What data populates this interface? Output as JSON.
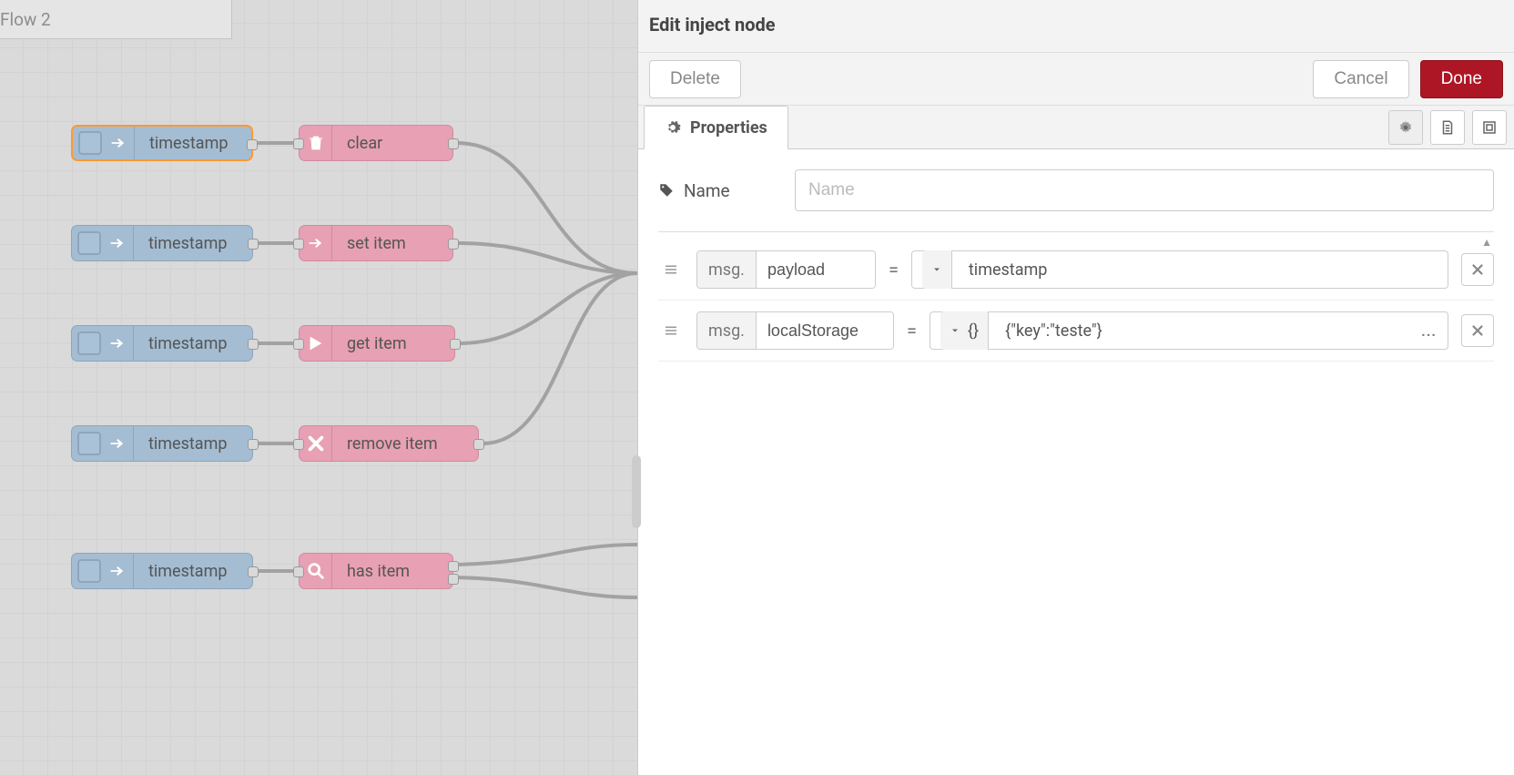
{
  "workspace": {
    "tab_label": "Flow 2",
    "inject_label": "timestamp",
    "nodes": [
      {
        "label": "clear",
        "icon": "trash"
      },
      {
        "label": "set item",
        "icon": "arrow"
      },
      {
        "label": "get item",
        "icon": "arrow-solid"
      },
      {
        "label": "remove item",
        "icon": "x"
      },
      {
        "label": "has item",
        "icon": "search"
      }
    ]
  },
  "panel": {
    "title": "Edit inject node",
    "delete_label": "Delete",
    "cancel_label": "Cancel",
    "done_label": "Done",
    "properties_tab": "Properties",
    "name_label": "Name",
    "name_placeholder": "Name",
    "msg_prefix": "msg.",
    "equals": "=",
    "rows": [
      {
        "prop": "payload",
        "type_label": "timestamp",
        "type_icon": "clock",
        "value": "",
        "expandable": false
      },
      {
        "prop": "localStorage",
        "type_label": "{}",
        "type_icon": "json",
        "value": "{\"key\":\"teste\"}",
        "expandable": true
      }
    ],
    "expand_label": "..."
  }
}
